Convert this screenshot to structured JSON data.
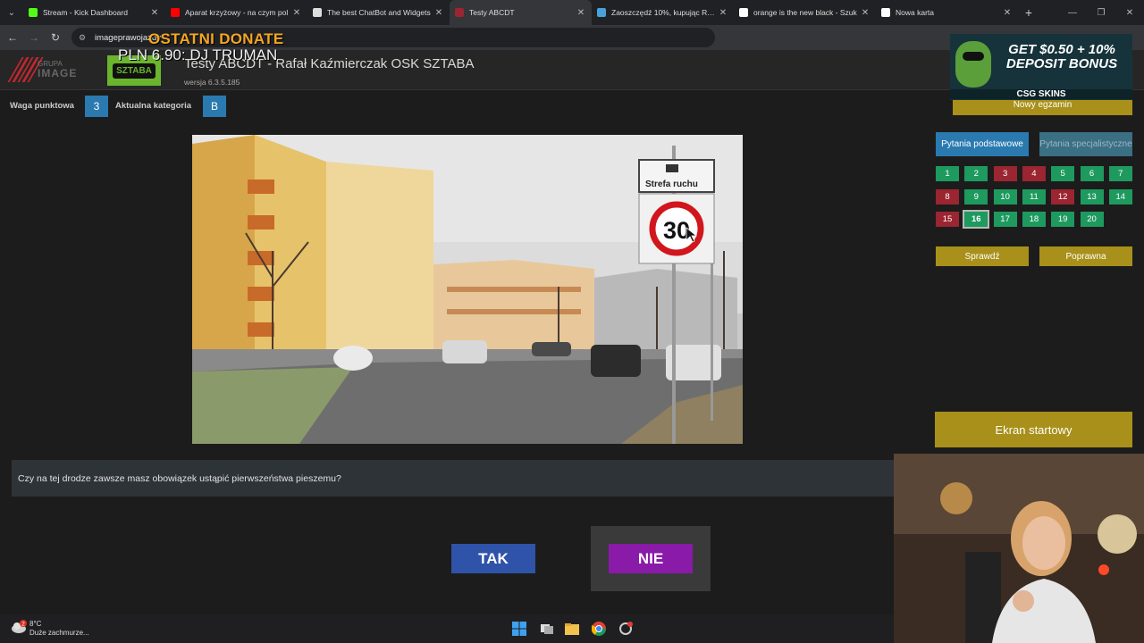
{
  "browser": {
    "tabs": [
      {
        "title": "Stream - Kick Dashboard",
        "color": "#53fc18"
      },
      {
        "title": "Aparat krzyżowy - na czym pol",
        "color": "#ff0000"
      },
      {
        "title": "The best ChatBot and Widgets",
        "color": "#dddddd"
      },
      {
        "title": "Testy ABCDT",
        "color": "#9b2530"
      },
      {
        "title": "Zaoszczędź 10%, kupując RV T",
        "color": "#4aa0d8"
      },
      {
        "title": "orange is the new black - Szuk",
        "color": "#ffffff"
      },
      {
        "title": "Nowa karta",
        "color": "#ffffff"
      }
    ],
    "url": "imageprawojazdy"
  },
  "overlay": {
    "donate_title": "OSTATNI DONATE",
    "donate_value": "PLN 6.90: DJ TRUMAN"
  },
  "header": {
    "title": "Testy ABCDT - Rafał Kaźmierczak OSK SZTABA",
    "version": "wersja 6.3.5.185",
    "logo_text": "SZTABA",
    "group_logo_top": "GRUPA",
    "group_logo_bottom": "IMAGE"
  },
  "info": {
    "weight_label": "Waga punktowa",
    "weight_value": "3",
    "category_label": "Aktualna kategoria",
    "category_value": "B"
  },
  "photo": {
    "sign_plate": "Strefa ruchu",
    "sign_limit": "30"
  },
  "question": {
    "text": "Czy na tej drodze zawsze masz obowiązek ustąpić pierwszeństwa pieszemu?",
    "yes": "TAK",
    "no": "NIE"
  },
  "sidebar": {
    "ad_line": "GET $0.50 + 10% DEPOSIT BONUS",
    "ad_brand": "CSG SKINS",
    "new_exam": "Nowy egzamin",
    "tab_basic": "Pytania podstawowe",
    "tab_special": "Pytania specjalistyczne",
    "questions": [
      {
        "n": "1",
        "s": "ok"
      },
      {
        "n": "2",
        "s": "ok"
      },
      {
        "n": "3",
        "s": "bad"
      },
      {
        "n": "4",
        "s": "bad"
      },
      {
        "n": "5",
        "s": "ok"
      },
      {
        "n": "6",
        "s": "ok"
      },
      {
        "n": "7",
        "s": "ok"
      },
      {
        "n": "8",
        "s": "bad"
      },
      {
        "n": "9",
        "s": "ok"
      },
      {
        "n": "10",
        "s": "ok"
      },
      {
        "n": "11",
        "s": "ok"
      },
      {
        "n": "12",
        "s": "bad"
      },
      {
        "n": "13",
        "s": "ok"
      },
      {
        "n": "14",
        "s": "ok"
      },
      {
        "n": "15",
        "s": "bad"
      },
      {
        "n": "16",
        "s": "cur"
      },
      {
        "n": "17",
        "s": "ok"
      },
      {
        "n": "18",
        "s": "ok"
      },
      {
        "n": "19",
        "s": "ok"
      },
      {
        "n": "20",
        "s": "ok"
      }
    ],
    "check": "Sprawdź",
    "correct": "Poprawna",
    "start_screen": "Ekran startowy"
  },
  "taskbar": {
    "temp": "8°C",
    "weather": "Duże zachmurze...",
    "badge": "2"
  }
}
